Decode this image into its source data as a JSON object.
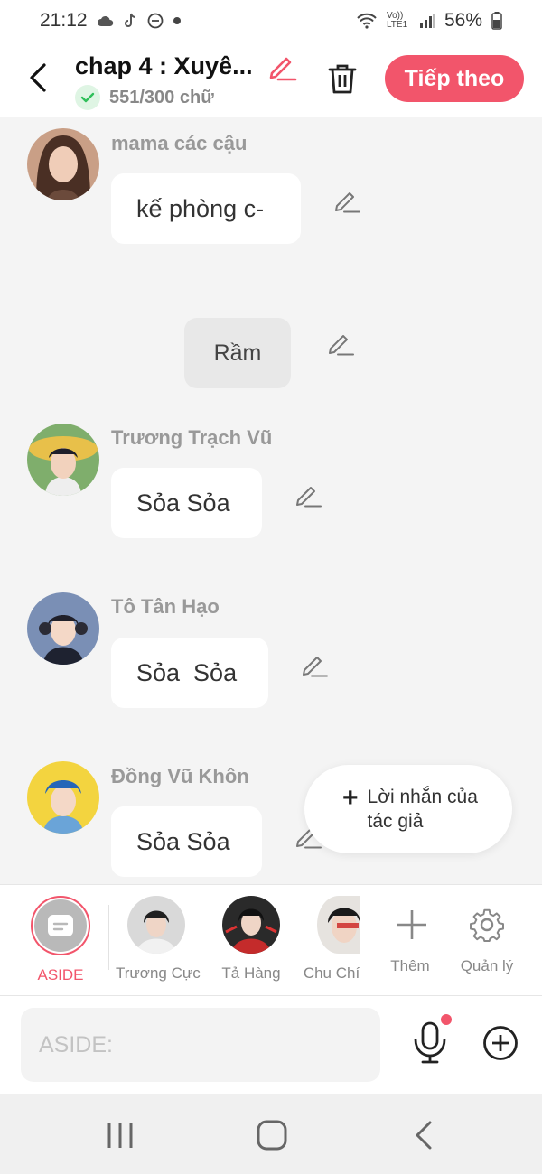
{
  "status_bar": {
    "time": "21:12",
    "battery": "56%",
    "network": "Vo)) LTE1"
  },
  "header": {
    "title": "chap 4 : Xuyê...",
    "word_count": "551/300 chữ",
    "next_label": "Tiếp theo"
  },
  "messages": [
    {
      "sender": "mama các cậu",
      "text": "kế phòng c-"
    },
    {
      "text": "Rầm"
    },
    {
      "sender": "Trương Trạch Vũ",
      "text": "Sỏa Sỏa"
    },
    {
      "sender": "Tô Tân Hạo",
      "text": "Sỏa  Sỏa"
    },
    {
      "sender": "Đồng Vũ Khôn",
      "text": "Sỏa Sỏa"
    }
  ],
  "author_note": {
    "label": "Lời nhắn của tác giả"
  },
  "characters": [
    {
      "label": "ASIDE"
    },
    {
      "label": "Trương Cực"
    },
    {
      "label": "Tả Hàng"
    },
    {
      "label": "Chu Chí"
    }
  ],
  "char_actions": {
    "add_label": "Thêm",
    "manage_label": "Quản lý"
  },
  "input": {
    "placeholder": "ASIDE:"
  },
  "colors": {
    "accent": "#f2556b",
    "background": "#f4f4f4",
    "success": "#2fbf5a"
  }
}
